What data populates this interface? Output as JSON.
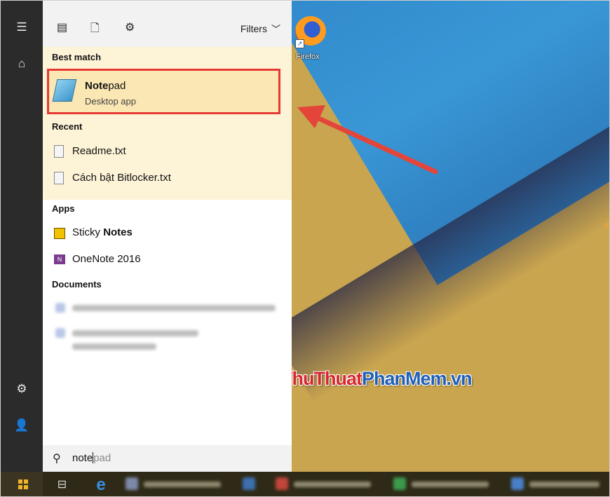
{
  "desktop": {
    "icons": [
      {
        "label": "Firefox",
        "icon": "firefox-icon"
      }
    ],
    "watermark": {
      "part1": "ThuThuat",
      "part2": "PhanMem.vn"
    }
  },
  "rail": {
    "icons": [
      "hamburger-icon",
      "home-icon",
      "gear-icon",
      "user-icon"
    ]
  },
  "panel": {
    "topbar": {
      "icons": [
        "document-view-icon",
        "blank-document-icon",
        "gear-icon"
      ],
      "filters_label": "Filters"
    },
    "best_match": {
      "heading": "Best match",
      "title_bold": "Note",
      "title_rest": "pad",
      "subtitle": "Desktop app"
    },
    "recent": {
      "heading": "Recent",
      "items": [
        "Readme.txt",
        "Cách bật Bitlocker.txt"
      ]
    },
    "apps": {
      "heading": "Apps",
      "items": [
        {
          "label_pre": "Sticky ",
          "label_bold": "Notes",
          "icon": "sticky-notes-icon"
        },
        {
          "label_pre": "OneNote 2016",
          "label_bold": "",
          "icon": "onenote-icon"
        }
      ]
    },
    "documents": {
      "heading": "Documents"
    },
    "search": {
      "typed": "note",
      "suggestion": "pad"
    }
  },
  "taskbar": {
    "icons": [
      "windows-start-icon",
      "task-view-icon",
      "edge-icon"
    ]
  },
  "colors": {
    "rail": "#2b2b2b",
    "highlight_border": "#e53935",
    "results_bg": "#fdf3d7",
    "arrow": "#e4453a"
  }
}
